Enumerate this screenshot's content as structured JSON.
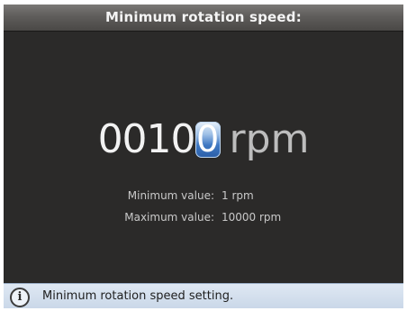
{
  "title": "Minimum rotation speed:",
  "value": {
    "digits": "0010",
    "cursor_digit": "0",
    "unit": "rpm"
  },
  "limits": {
    "min_label": "Minimum value:",
    "min_value": "1 rpm",
    "max_label": "Maximum value:",
    "max_value": "10000 rpm"
  },
  "status": {
    "icon": "info-icon",
    "icon_glyph": "i",
    "text": "Minimum rotation speed setting."
  },
  "colors": {
    "background": "#2b2a29",
    "cursor_highlight": "#3f78c2",
    "status_bar": "#c9d7e8"
  }
}
